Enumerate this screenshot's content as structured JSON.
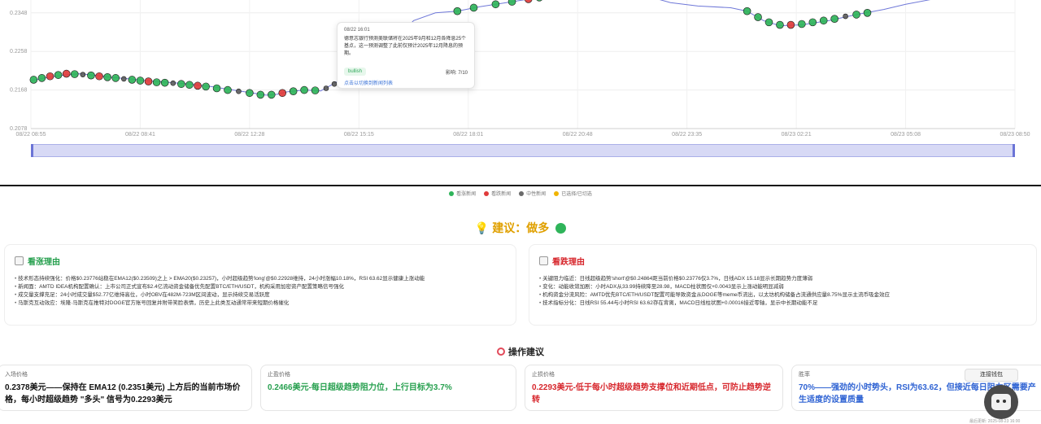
{
  "chart_data": {
    "type": "line",
    "title": "",
    "y_tick_labels": [
      "0.2348",
      "0.2258",
      "0.2168",
      "0.2078"
    ],
    "x_tick_labels": [
      "08/22 08:55",
      "08/22 08:41",
      "08/22 12:28",
      "08/22 15:15",
      "08/22 18:01",
      "08/22 20:48",
      "08/22 23:35",
      "08/23 02:21",
      "08/23 05:08",
      "08/23 08:50"
    ],
    "price": [
      [
        0,
        0.219
      ],
      [
        6,
        0.2197
      ],
      [
        12,
        0.2203
      ],
      [
        18,
        0.2206
      ],
      [
        24,
        0.2202
      ],
      [
        30,
        0.2197
      ],
      [
        36,
        0.2194
      ],
      [
        42,
        0.219
      ],
      [
        50,
        0.2186
      ],
      [
        58,
        0.2182
      ],
      [
        66,
        0.2176
      ],
      [
        74,
        0.2168
      ],
      [
        82,
        0.216
      ],
      [
        86,
        0.2156
      ],
      [
        90,
        0.2158
      ],
      [
        94,
        0.2164
      ],
      [
        100,
        0.2168
      ],
      [
        106,
        0.2166
      ],
      [
        110,
        0.218
      ],
      [
        114,
        0.2195
      ],
      [
        118,
        0.2215
      ],
      [
        122,
        0.224
      ],
      [
        126,
        0.2258
      ],
      [
        130,
        0.2264
      ],
      [
        134,
        0.229
      ],
      [
        140,
        0.233
      ],
      [
        148,
        0.2348
      ],
      [
        156,
        0.2352
      ],
      [
        164,
        0.2362
      ],
      [
        172,
        0.237
      ],
      [
        180,
        0.2378
      ],
      [
        190,
        0.2388
      ],
      [
        200,
        0.2398
      ],
      [
        210,
        0.24
      ],
      [
        218,
        0.2398
      ],
      [
        226,
        0.2386
      ],
      [
        234,
        0.2372
      ],
      [
        244,
        0.2364
      ],
      [
        256,
        0.236
      ],
      [
        262,
        0.2352
      ],
      [
        268,
        0.233
      ],
      [
        274,
        0.2318
      ],
      [
        282,
        0.232
      ],
      [
        292,
        0.233
      ],
      [
        302,
        0.2344
      ],
      [
        312,
        0.2356
      ],
      [
        320,
        0.2368
      ],
      [
        330,
        0.238
      ],
      [
        340,
        0.2382
      ],
      [
        350,
        0.239
      ],
      [
        360,
        0.2394
      ]
    ],
    "markers": [
      {
        "t": 1,
        "p": 0.2192,
        "s": "bull"
      },
      {
        "t": 4,
        "p": 0.2196,
        "s": "bull"
      },
      {
        "t": 7,
        "p": 0.22,
        "s": "bear"
      },
      {
        "t": 10,
        "p": 0.2203,
        "s": "bull"
      },
      {
        "t": 13,
        "p": 0.2206,
        "s": "bear"
      },
      {
        "t": 16,
        "p": 0.2205,
        "s": "bull"
      },
      {
        "t": 19,
        "p": 0.2204,
        "s": "neutral"
      },
      {
        "t": 22,
        "p": 0.2202,
        "s": "bull"
      },
      {
        "t": 25,
        "p": 0.22,
        "s": "bear"
      },
      {
        "t": 28,
        "p": 0.2198,
        "s": "bull"
      },
      {
        "t": 31,
        "p": 0.2196,
        "s": "bull"
      },
      {
        "t": 34,
        "p": 0.2194,
        "s": "neutral"
      },
      {
        "t": 37,
        "p": 0.2192,
        "s": "bull"
      },
      {
        "t": 40,
        "p": 0.219,
        "s": "bull"
      },
      {
        "t": 43,
        "p": 0.2188,
        "s": "bear"
      },
      {
        "t": 46,
        "p": 0.2186,
        "s": "bull"
      },
      {
        "t": 49,
        "p": 0.2185,
        "s": "bull"
      },
      {
        "t": 52,
        "p": 0.2184,
        "s": "neutral"
      },
      {
        "t": 55,
        "p": 0.2182,
        "s": "bull"
      },
      {
        "t": 58,
        "p": 0.218,
        "s": "bull"
      },
      {
        "t": 61,
        "p": 0.2178,
        "s": "bear"
      },
      {
        "t": 64,
        "p": 0.2176,
        "s": "bull"
      },
      {
        "t": 68,
        "p": 0.2172,
        "s": "bull"
      },
      {
        "t": 72,
        "p": 0.2168,
        "s": "bull"
      },
      {
        "t": 76,
        "p": 0.2165,
        "s": "neutral"
      },
      {
        "t": 80,
        "p": 0.2161,
        "s": "bull"
      },
      {
        "t": 84,
        "p": 0.2157,
        "s": "bull"
      },
      {
        "t": 88,
        "p": 0.2157,
        "s": "bull"
      },
      {
        "t": 92,
        "p": 0.2161,
        "s": "bear"
      },
      {
        "t": 96,
        "p": 0.2165,
        "s": "bull"
      },
      {
        "t": 100,
        "p": 0.2168,
        "s": "bull"
      },
      {
        "t": 104,
        "p": 0.2167,
        "s": "bull"
      },
      {
        "t": 108,
        "p": 0.2172,
        "s": "neutral"
      },
      {
        "t": 111,
        "p": 0.2182,
        "s": "neutral"
      },
      {
        "t": 114,
        "p": 0.2195,
        "s": "neutral"
      },
      {
        "t": 117,
        "p": 0.221,
        "s": "bull"
      },
      {
        "t": 156,
        "p": 0.2352,
        "s": "bull"
      },
      {
        "t": 162,
        "p": 0.236,
        "s": "bull"
      },
      {
        "t": 170,
        "p": 0.2368,
        "s": "bull"
      },
      {
        "t": 176,
        "p": 0.2374,
        "s": "bull"
      },
      {
        "t": 182,
        "p": 0.238,
        "s": "bear"
      },
      {
        "t": 186,
        "p": 0.2384,
        "s": "bull"
      },
      {
        "t": 192,
        "p": 0.239,
        "s": "bull"
      },
      {
        "t": 198,
        "p": 0.2396,
        "s": "bull"
      },
      {
        "t": 204,
        "p": 0.24,
        "s": "bull"
      },
      {
        "t": 210,
        "p": 0.24,
        "s": "neutral"
      },
      {
        "t": 262,
        "p": 0.2352,
        "s": "bull"
      },
      {
        "t": 266,
        "p": 0.2338,
        "s": "bull"
      },
      {
        "t": 270,
        "p": 0.2326,
        "s": "bull"
      },
      {
        "t": 274,
        "p": 0.232,
        "s": "bull"
      },
      {
        "t": 278,
        "p": 0.232,
        "s": "bear"
      },
      {
        "t": 282,
        "p": 0.2322,
        "s": "bull"
      },
      {
        "t": 286,
        "p": 0.2326,
        "s": "bull"
      },
      {
        "t": 290,
        "p": 0.233,
        "s": "bull"
      },
      {
        "t": 294,
        "p": 0.2334,
        "s": "bull"
      },
      {
        "t": 298,
        "p": 0.234,
        "s": "neutral"
      },
      {
        "t": 302,
        "p": 0.2344,
        "s": "bull"
      },
      {
        "t": 306,
        "p": 0.2348,
        "s": "bull"
      }
    ],
    "ylim": [
      0.2078,
      0.2378
    ],
    "xlim": [
      0,
      360
    ]
  },
  "tooltip": {
    "time": "08/22 16:01",
    "text": "德意志银行预测美联储将在2025年9月和12月各降息25个基点，这一预测调整了此前仅预计2025年12月降息的预期。",
    "badge": "bullish",
    "impact": "影响: 7/10",
    "link": "点击以切换到新闻列表"
  },
  "legend": [
    {
      "label": "看涨新闻",
      "color": "#2fb45a"
    },
    {
      "label": "看跌新闻",
      "color": "#e03b3b"
    },
    {
      "label": "中性新闻",
      "color": "#6a6a6a"
    },
    {
      "label": "已选择/已切选",
      "color": "#f0b400"
    }
  ],
  "advice": {
    "text": "建议：做多"
  },
  "bull": {
    "title": "看涨理由",
    "items": [
      "技术形态持续强化：价格$0.23776站稳在EMA12($0.23509)之上 > EMA20($0.23257)，小时超级趋势'long'@$0.22928维持，24小时涨幅10.18%，RSI 63.62显示健康上涨动能",
      "新闻面：AMTD IDEA机构配置确认：上市公司正式宣布$2.4亿流动资金储备优先配置BTC/ETH/USDT，机构采用加密资产配置策略信号强化",
      "成交量支撑充足：24小时成交量$52.77亿维持高位，小时OBV在482M-723M区间波动，显示持续交易活跃度",
      "马斯克互动效应：埃隆·马斯克在推特对DOGE官方账号回复并附带笑脸表情，历史上此类互动通常带来短期价格催化"
    ]
  },
  "bear": {
    "title": "看跌理由",
    "items": [
      "关键阻力临近：日线超级趋势'short'@$0.24864距当前价格$0.23776仅3.7%，日线ADX 15.18显示长期趋势力度薄弱",
      "变化：动能收敛加剧：小时ADX从33.99持续降至28.98，MACD柱状图仅+0.0043显示上涨动能明显减弱",
      "机构资金分流风险：AMTD优先BTC/ETH/USDT配置可能导致资金从DOGE等meme币流出，以太坊机构储备占流通供应量8.75%显示主流币吸金效应",
      "技术指标分化：日线RSI 55.44与小时RSI 63.62存在背离，MACD日线柱状图+0.00016接近零轴，显示中长期动能不足"
    ]
  },
  "ops": {
    "title": "操作建议",
    "cards": [
      {
        "label": "入场价格",
        "value": "0.2378美元——保持在 EMA12 (0.2351美元) 上方后的当前市场价格，每小时超级趋势 \"多头\" 信号为0.2293美元"
      },
      {
        "label": "止盈价格",
        "value": "0.2466美元-每日超级趋势阻力位，上行目标为3.7%"
      },
      {
        "label": "止损价格",
        "value": "0.2293美元-低于每小时超级趋势支撑位和近期低点，可防止趋势逆转"
      },
      {
        "label": "胜率",
        "value": "70%——强劲的小时势头，RSI为63.62，但接近每日阻力区需要产生适度的设置质量"
      }
    ]
  },
  "connect_label": "连接钱包",
  "footer": "最后更新: 2025-08-23 16:00"
}
